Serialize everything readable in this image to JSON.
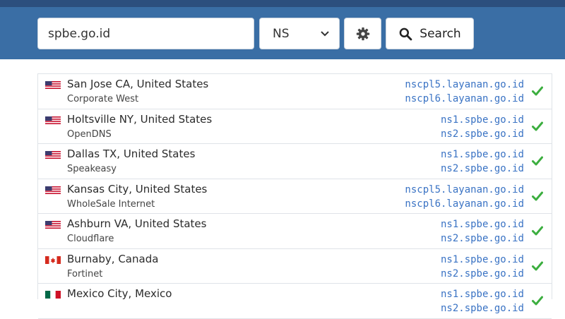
{
  "search": {
    "query": "spbe.go.id",
    "button_label": "Search"
  },
  "record_type": {
    "selected": "NS"
  },
  "colors": {
    "header": "#3a6ea5",
    "link": "#3a73c4",
    "success": "#3cae3f"
  },
  "results": [
    {
      "flag": "us",
      "location": "San Jose CA, United States",
      "provider": "Corporate West",
      "ns": [
        "nscpl5.layanan.go.id",
        "nscpl6.layanan.go.id"
      ],
      "status": "ok"
    },
    {
      "flag": "us",
      "location": "Holtsville NY, United States",
      "provider": "OpenDNS",
      "ns": [
        "ns1.spbe.go.id",
        "ns2.spbe.go.id"
      ],
      "status": "ok"
    },
    {
      "flag": "us",
      "location": "Dallas TX, United States",
      "provider": "Speakeasy",
      "ns": [
        "ns1.spbe.go.id",
        "ns2.spbe.go.id"
      ],
      "status": "ok"
    },
    {
      "flag": "us",
      "location": "Kansas City, United States",
      "provider": "WholeSale Internet",
      "ns": [
        "nscpl5.layanan.go.id",
        "nscpl6.layanan.go.id"
      ],
      "status": "ok"
    },
    {
      "flag": "us",
      "location": "Ashburn VA, United States",
      "provider": "Cloudflare",
      "ns": [
        "ns1.spbe.go.id",
        "ns2.spbe.go.id"
      ],
      "status": "ok"
    },
    {
      "flag": "ca",
      "location": "Burnaby, Canada",
      "provider": "Fortinet",
      "ns": [
        "ns1.spbe.go.id",
        "ns2.spbe.go.id"
      ],
      "status": "ok"
    },
    {
      "flag": "mx",
      "location": "Mexico City, Mexico",
      "provider": "",
      "ns": [
        "ns1.spbe.go.id",
        "ns2.spbe.go.id"
      ],
      "status": "ok"
    }
  ]
}
